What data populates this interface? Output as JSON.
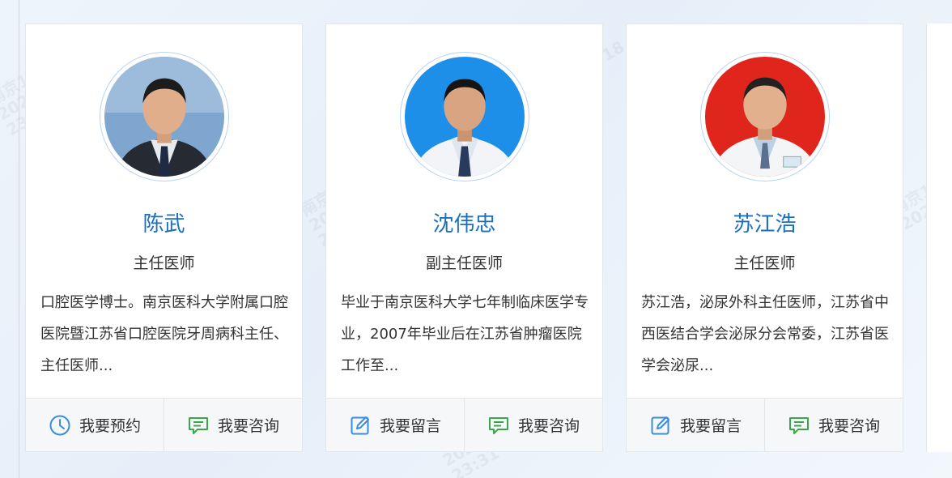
{
  "watermark": {
    "line1": "南京12320",
    "line2": "2025-08-18",
    "line3": "23:31"
  },
  "doctors": [
    {
      "name": "陈武",
      "title": "主任医师",
      "desc": "口腔医学博士。南京医科大学附属口腔医院暨江苏省口腔医院牙周病科主任、主任医师...",
      "avatar_bg": "#7ea6cf",
      "actions": [
        {
          "label": "我要预约",
          "icon": "clock-icon"
        },
        {
          "label": "我要咨询",
          "icon": "chat-icon"
        }
      ]
    },
    {
      "name": "沈伟忠",
      "title": "副主任医师",
      "desc": "毕业于南京医科大学七年制临床医学专业，2007年毕业后在江苏省肿瘤医院工作至...",
      "avatar_bg": "#1e8fe8",
      "actions": [
        {
          "label": "我要留言",
          "icon": "edit-icon"
        },
        {
          "label": "我要咨询",
          "icon": "chat-icon"
        }
      ]
    },
    {
      "name": "苏江浩",
      "title": "主任医师",
      "desc": "苏江浩，泌尿外科主任医师，江苏省中西医结合学会泌尿分会常委，江苏省医学会泌尿...",
      "avatar_bg": "#e0261c",
      "actions": [
        {
          "label": "我要留言",
          "icon": "edit-icon"
        },
        {
          "label": "我要咨询",
          "icon": "chat-icon"
        }
      ]
    }
  ],
  "colors": {
    "name_blue": "#1a6fbf",
    "icon_blue": "#3b8be0",
    "icon_green": "#3aa84a"
  }
}
